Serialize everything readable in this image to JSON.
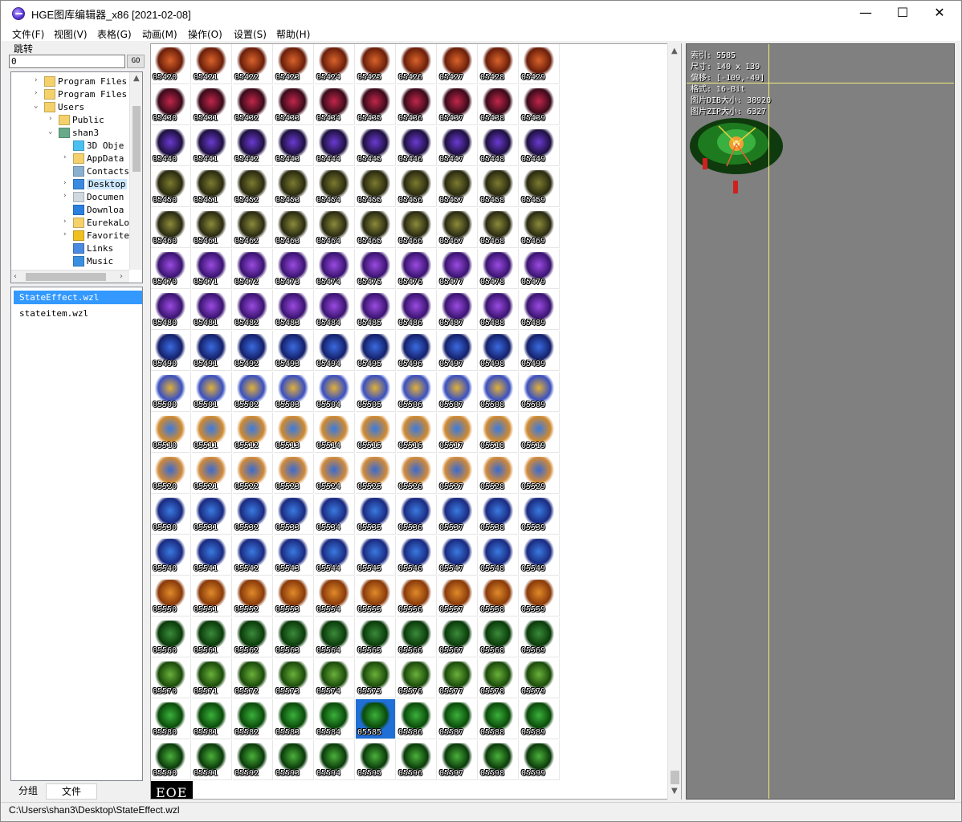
{
  "window": {
    "title": "HGE图库编辑器_x86 [2021-02-08]",
    "minimize": "—",
    "maximize": "☐",
    "close": "✕"
  },
  "menu": [
    "文件(F)",
    "视图(V)",
    "表格(G)",
    "动画(M)",
    "操作(O)",
    "设置(S)",
    "帮助(H)"
  ],
  "jump": {
    "label": "跳转",
    "value": "0",
    "go_label": "GO"
  },
  "tree": [
    {
      "label": "Program Files",
      "indent": 2,
      "expander": "›",
      "icon": "folder-icon"
    },
    {
      "label": "Program Files",
      "indent": 2,
      "expander": "›",
      "icon": "folder-icon"
    },
    {
      "label": "Users",
      "indent": 2,
      "expander": "⌄",
      "icon": "folder-icon"
    },
    {
      "label": "Public",
      "indent": 3,
      "expander": "›",
      "icon": "folder-icon"
    },
    {
      "label": "shan3",
      "indent": 3,
      "expander": "⌄",
      "icon": "user-icon"
    },
    {
      "label": "3D Obje",
      "indent": 4,
      "expander": "",
      "icon": "cube-icon"
    },
    {
      "label": "AppData",
      "indent": 4,
      "expander": "›",
      "icon": "folder-icon"
    },
    {
      "label": "Contacts",
      "indent": 4,
      "expander": "",
      "icon": "contacts-icon"
    },
    {
      "label": "Desktop",
      "indent": 4,
      "expander": "›",
      "icon": "desktop-icon",
      "selected": true
    },
    {
      "label": "Documen",
      "indent": 4,
      "expander": "›",
      "icon": "document-icon"
    },
    {
      "label": "Downloa",
      "indent": 4,
      "expander": "",
      "icon": "download-icon"
    },
    {
      "label": "EurekaLo",
      "indent": 4,
      "expander": "›",
      "icon": "folder-icon"
    },
    {
      "label": "Favorite",
      "indent": 4,
      "expander": "›",
      "icon": "star-icon"
    },
    {
      "label": "Links",
      "indent": 4,
      "expander": "",
      "icon": "link-icon"
    },
    {
      "label": "Music",
      "indent": 4,
      "expander": "",
      "icon": "music-icon"
    }
  ],
  "files": [
    {
      "name": "StateEffect.wzl",
      "selected": true
    },
    {
      "name": "stateitem.wzl",
      "selected": false
    }
  ],
  "tabs": [
    {
      "label": "分组",
      "active": true
    },
    {
      "label": "文件",
      "active": false
    }
  ],
  "grid": {
    "start_index": 5420,
    "columns": 10,
    "rows": 18,
    "selected_index": 5585,
    "row_colors": [
      [
        "#d9622a",
        "#6a1e0a"
      ],
      [
        "#c0264a",
        "#3a0a1a"
      ],
      [
        "#6a3ad0",
        "#1e1040"
      ],
      [
        "#7a7a30",
        "#2a2a10"
      ],
      [
        "#8a8a3a",
        "#2a2a12"
      ],
      [
        "#9a4ae0",
        "#3a1470"
      ],
      [
        "#9a4ae0",
        "#3a1470"
      ],
      [
        "#3a6ae0",
        "#14206a"
      ],
      [
        "#e0b03a",
        "#3a50c0"
      ],
      [
        "#3a7ae0",
        "#d08a30"
      ],
      [
        "#3a6ad0",
        "#d08a3a"
      ],
      [
        "#3a7ae0",
        "#1a2a80"
      ],
      [
        "#3a7ae0",
        "#1a2a80"
      ],
      [
        "#e08a2a",
        "#8a3a0a"
      ],
      [
        "#3a8a3a",
        "#0a3a0a"
      ],
      [
        "#6ab03a",
        "#1a4a0a"
      ],
      [
        "#3ab03a",
        "#0a4a0a"
      ],
      [
        "#4ab03a",
        "#0a3a0a"
      ]
    ],
    "partial_label": "EOE"
  },
  "preview": {
    "index_line": "索引: 5585",
    "size_line": "尺寸: 140 x 139",
    "offset_line": "偏移: [-109,-49]",
    "format_line": "格式: 16-Bit",
    "dib_line": "图片DIB大小: 38920",
    "zip_line": "图片ZIP大小: 6327"
  },
  "status": {
    "path": "C:\\Users\\shan3\\Desktop\\StateEffect.wzl"
  }
}
